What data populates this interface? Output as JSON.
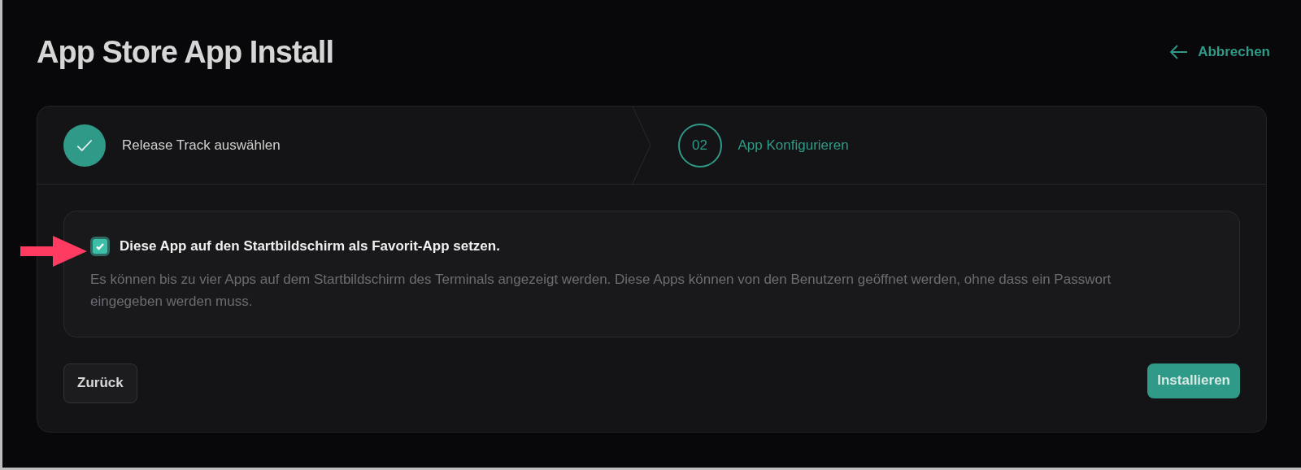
{
  "title": "App Store App Install",
  "cancel_link": {
    "label": "Abbrechen"
  },
  "steps": [
    {
      "label": "Release Track auswählen",
      "completed": true,
      "selected": false
    },
    {
      "number": "02",
      "label": "App Konfigurieren",
      "completed": false,
      "selected": true
    }
  ],
  "option": {
    "checked": true,
    "label": "Diese App auf den Startbildschirm als Favorit-App setzen.",
    "description": "Es können bis zu vier Apps auf dem Startbildschirm des Terminals angezeigt werden. Diese Apps können von den Benutzern geöffnet werden, ohne dass ein Passwort eingegeben werden muss."
  },
  "back_button": {
    "label": "Zurück"
  },
  "install_button": {
    "label": "Installieren"
  }
}
